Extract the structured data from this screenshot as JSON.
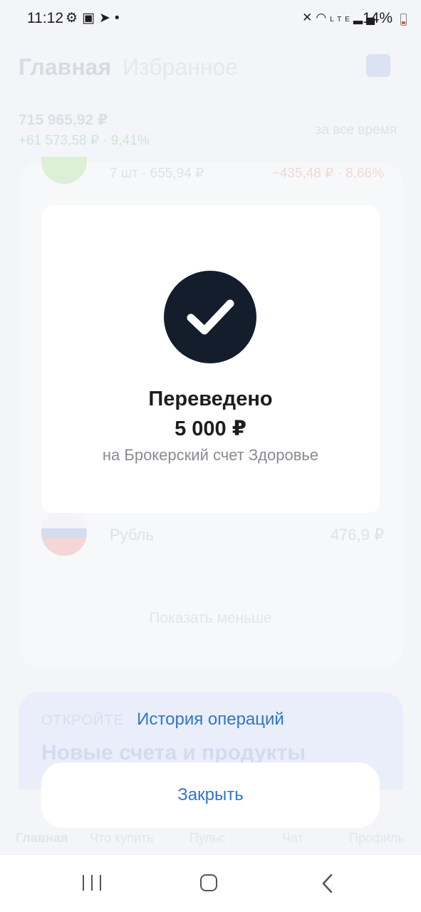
{
  "status_bar": {
    "time": "11:12",
    "battery": "14%",
    "left_icons": [
      "gear-icon",
      "image-icon",
      "telegram-icon",
      "dot-icon"
    ],
    "right_icons": [
      "mute-icon",
      "wifi-icon",
      "volte-icon",
      "signal-icon",
      "battery-icon"
    ]
  },
  "background": {
    "tabs": [
      "Главная",
      "Избранное"
    ],
    "total": "715 965,92 ₽",
    "change": "+61 573,58 ₽ · 9,41%",
    "period": "за все время",
    "row1": {
      "qty": "7 шт · 655,94 ₽",
      "change": "−435,48 ₽ · 8,66%"
    },
    "ruble": {
      "name": "Рубль",
      "value": "476,9 ₽"
    },
    "show_less": "Показать меньше",
    "promo": {
      "label": "ОТКРОЙТЕ",
      "title": "Новые счета и продукты"
    },
    "bottom_tabs": [
      "Главная",
      "Что купить",
      "Пульс",
      "Чат",
      "Профиль"
    ]
  },
  "dialog": {
    "title": "Переведено",
    "amount": "5 000 ₽",
    "subtitle": "на Брокерский счет Здоровье"
  },
  "history_link": "История операций",
  "close_button": "Закрыть",
  "colors": {
    "accent": "#3275c9",
    "check_circle": "#141d2b"
  }
}
